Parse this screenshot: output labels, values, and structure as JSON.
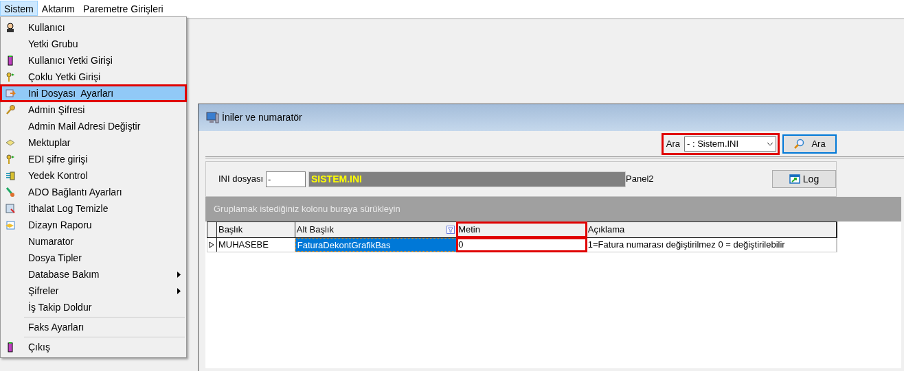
{
  "menubar": [
    {
      "label": "Sistem",
      "selected": true
    },
    {
      "label": "Aktarım",
      "selected": false
    },
    {
      "label": "Paremetre Girişleri",
      "selected": false
    }
  ],
  "menu": {
    "items": [
      {
        "kind": "item",
        "label": "Kullanıcı",
        "selected": false,
        "submenu": false,
        "marked": false
      },
      {
        "kind": "item",
        "label": "Yetki Grubu",
        "selected": false,
        "submenu": false,
        "marked": false
      },
      {
        "kind": "item",
        "label": "Kullanıcı Yetki Girişi",
        "selected": false,
        "submenu": false,
        "marked": false
      },
      {
        "kind": "item",
        "label": "Çoklu Yetki Girişi",
        "selected": false,
        "submenu": false,
        "marked": false
      },
      {
        "kind": "item",
        "label": "Ini Dosyası  Ayarları",
        "selected": true,
        "submenu": false,
        "marked": true
      },
      {
        "kind": "item",
        "label": "Admin Şifresi",
        "selected": false,
        "submenu": false,
        "marked": false
      },
      {
        "kind": "item",
        "label": "Admin Mail Adresi Değiştir",
        "selected": false,
        "submenu": false,
        "marked": false
      },
      {
        "kind": "item",
        "label": "Mektuplar",
        "selected": false,
        "submenu": false,
        "marked": false
      },
      {
        "kind": "item",
        "label": "EDI şifre girişi",
        "selected": false,
        "submenu": false,
        "marked": false
      },
      {
        "kind": "item",
        "label": "Yedek Kontrol",
        "selected": false,
        "submenu": false,
        "marked": false
      },
      {
        "kind": "item",
        "label": "ADO Bağlantı Ayarları",
        "selected": false,
        "submenu": false,
        "marked": false
      },
      {
        "kind": "item",
        "label": "İthalat Log Temizle",
        "selected": false,
        "submenu": false,
        "marked": false
      },
      {
        "kind": "item",
        "label": "Dizayn Raporu",
        "selected": false,
        "submenu": false,
        "marked": false
      },
      {
        "kind": "item",
        "label": "Numarator",
        "selected": false,
        "submenu": false,
        "marked": false
      },
      {
        "kind": "item",
        "label": "Dosya Tipler",
        "selected": false,
        "submenu": false,
        "marked": false
      },
      {
        "kind": "item",
        "label": "Database Bakım",
        "selected": false,
        "submenu": true,
        "marked": false
      },
      {
        "kind": "item",
        "label": "Şifreler",
        "selected": false,
        "submenu": true,
        "marked": false
      },
      {
        "kind": "item",
        "label": "İş Takip Doldur",
        "selected": false,
        "submenu": false,
        "marked": false
      },
      {
        "kind": "separator"
      },
      {
        "kind": "item",
        "label": "Faks Ayarları",
        "selected": false,
        "submenu": false,
        "marked": false
      },
      {
        "kind": "separator"
      },
      {
        "kind": "item",
        "label": "Çıkış",
        "selected": false,
        "submenu": false,
        "marked": false
      }
    ]
  },
  "window": {
    "title": "İniler ve numaratör",
    "search": {
      "label": "Ara",
      "value": "- : Sistem.INI",
      "marked": true,
      "button": "Ara"
    },
    "ini": {
      "label": "INI dosyası",
      "value": "-",
      "file": "SISTEM.INI",
      "panel": "Panel2",
      "log_button": "Log"
    },
    "group_hint": "Gruplamak istediğiniz kolonu buraya sürükleyin",
    "table": {
      "columns": [
        {
          "label": "Başlık",
          "filter": false,
          "marked": false
        },
        {
          "label": "Alt Başlık",
          "filter": true,
          "marked": false
        },
        {
          "label": "Metin",
          "filter": false,
          "marked": true
        },
        {
          "label": "Açıklama",
          "filter": false,
          "marked": false
        }
      ],
      "rows": [
        {
          "current": true,
          "cells": [
            {
              "text": "MUHASEBE",
              "selected": false
            },
            {
              "text": "FaturaDekontGrafikBas",
              "selected": true
            },
            {
              "text": "0",
              "selected": false
            },
            {
              "text": "1=Fatura numarası değiştirilmez 0 = değiştirilebilir",
              "selected": false
            }
          ]
        }
      ]
    }
  }
}
